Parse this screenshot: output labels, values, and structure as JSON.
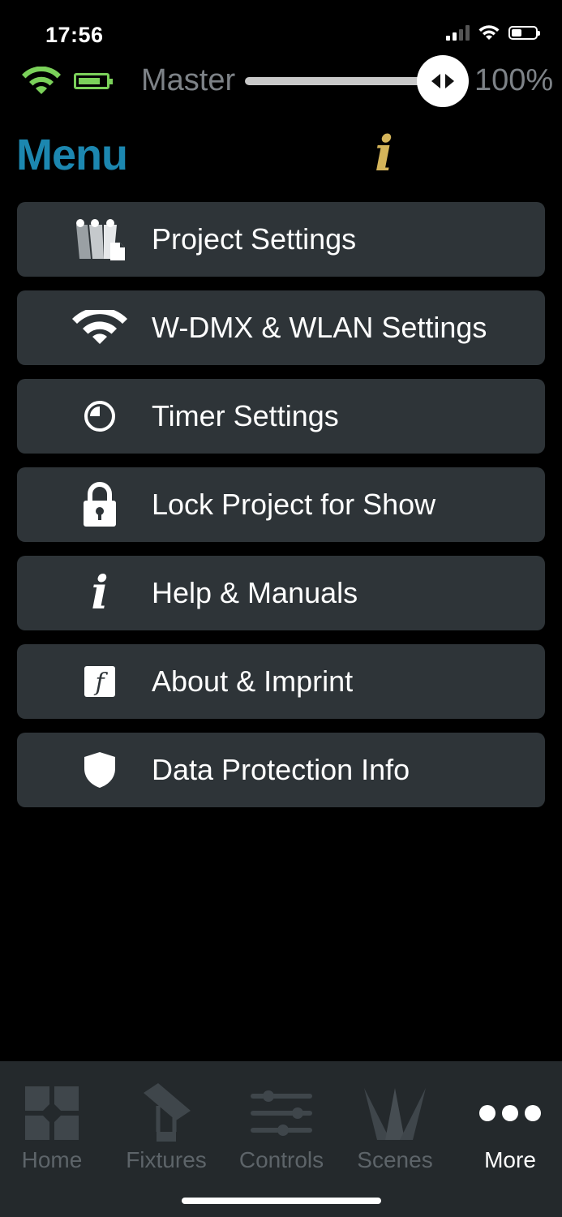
{
  "status_bar": {
    "time": "17:56"
  },
  "master": {
    "label": "Master",
    "value_text": "100%",
    "level": 1.0
  },
  "header": {
    "title": "Menu",
    "info_glyph": "i"
  },
  "menu": {
    "items": [
      {
        "label": "Project Settings",
        "icon": "project-settings-icon"
      },
      {
        "label": "W-DMX & WLAN Settings",
        "icon": "wifi-icon"
      },
      {
        "label": "Timer Settings",
        "icon": "timer-icon"
      },
      {
        "label": "Lock Project for Show",
        "icon": "lock-icon"
      },
      {
        "label": "Help & Manuals",
        "icon": "info-icon"
      },
      {
        "label": "About & Imprint",
        "icon": "about-icon"
      },
      {
        "label": "Data Protection Info",
        "icon": "shield-icon"
      }
    ]
  },
  "tabs": [
    {
      "label": "Home",
      "icon": "home-icon",
      "active": false
    },
    {
      "label": "Fixtures",
      "icon": "fixture-icon",
      "active": false
    },
    {
      "label": "Controls",
      "icon": "sliders-icon",
      "active": false
    },
    {
      "label": "Scenes",
      "icon": "scenes-icon",
      "active": false
    },
    {
      "label": "More",
      "icon": "more-icon",
      "active": true
    }
  ],
  "colors": {
    "accent": "#1c87b0",
    "info": "#d4b45a",
    "connection": "#7bd15a",
    "card": "#2e3438",
    "tab_bar": "#24292c"
  }
}
